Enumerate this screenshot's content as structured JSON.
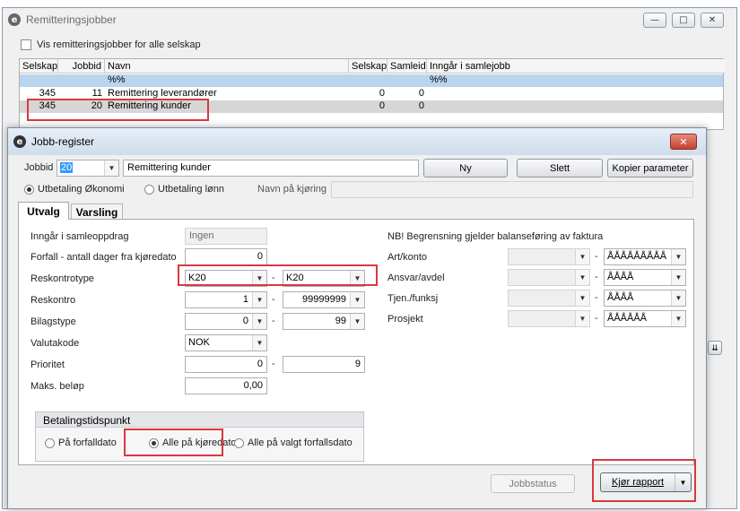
{
  "bg_window": {
    "title": "Remitteringsjobber",
    "checkbox_label": "Vis remitteringsjobber for alle selskap",
    "columns": [
      "Selskap",
      "Jobbid",
      "Navn",
      "Selskap",
      "Samleid",
      "Inngår i samlejobb"
    ],
    "filter_row": {
      "navn": "%%",
      "inngar": "%%"
    },
    "rows": [
      {
        "selskap": "345",
        "jobbid": "11",
        "navn": "Remittering leverandører",
        "selskap2": "0",
        "samleid": "0"
      },
      {
        "selskap": "345",
        "jobbid": "20",
        "navn": "Remittering kunder",
        "selskap2": "0",
        "samleid": "0"
      }
    ]
  },
  "dialog": {
    "title": "Jobb-register",
    "jobbid_label": "Jobbid",
    "jobbid_value": "20",
    "name_value": "Remittering kunder",
    "buttons": {
      "ny": "Ny",
      "slett": "Slett",
      "kopier": "Kopier parameter"
    },
    "radio_okonomi": "Utbetaling Økonomi",
    "radio_lonn": "Utbetaling lønn",
    "navn_pa_kjoring": "Navn på kjøring",
    "tabs": [
      "Utvalg",
      "Varsling"
    ],
    "left": {
      "samleoppdrag_label": "Inngår i samleoppdrag",
      "samleoppdrag_value": "Ingen",
      "forfall_label": "Forfall - antall dager fra kjøredato",
      "forfall_value": "0",
      "reskontrotype_label": "Reskontrotype",
      "reskontrotype_from": "K20",
      "reskontrotype_to": "K20",
      "reskontro_label": "Reskontro",
      "reskontro_from": "1",
      "reskontro_to": "99999999",
      "bilagstype_label": "Bilagstype",
      "bilagstype_from": "0",
      "bilagstype_to": "99",
      "valutakode_label": "Valutakode",
      "valutakode_value": "NOK",
      "prioritet_label": "Prioritet",
      "prioritet_from": "0",
      "prioritet_to": "9",
      "maks_label": "Maks. beløp",
      "maks_value": "0,00",
      "dash": "-"
    },
    "right": {
      "note": "NB! Begrensning gjelder balanseføring av faktura",
      "rows": [
        {
          "label": "Art/konto",
          "to": "ÅÅÅÅÅÅÅÅÅ"
        },
        {
          "label": "Ansvar/avdel",
          "to": "ÅÅÅÅ"
        },
        {
          "label": "Tjen./funksj",
          "to": "ÅÅÅÅ"
        },
        {
          "label": "Prosjekt",
          "to": "ÅÅÅÅÅÅ"
        }
      ]
    },
    "betaling": {
      "title": "Betalingstidspunkt",
      "opt1": "På forfalldato",
      "opt2": "Alle på kjøredato",
      "opt3": "Alle på valgt forfallsdato"
    },
    "jobbstatus": "Jobbstatus",
    "kjor_rapport": "Kjør rapport"
  },
  "colors": {
    "highlight": "#d9393f",
    "selected_row": "#d6d6d6",
    "filter_row": "#b9d5ee"
  }
}
